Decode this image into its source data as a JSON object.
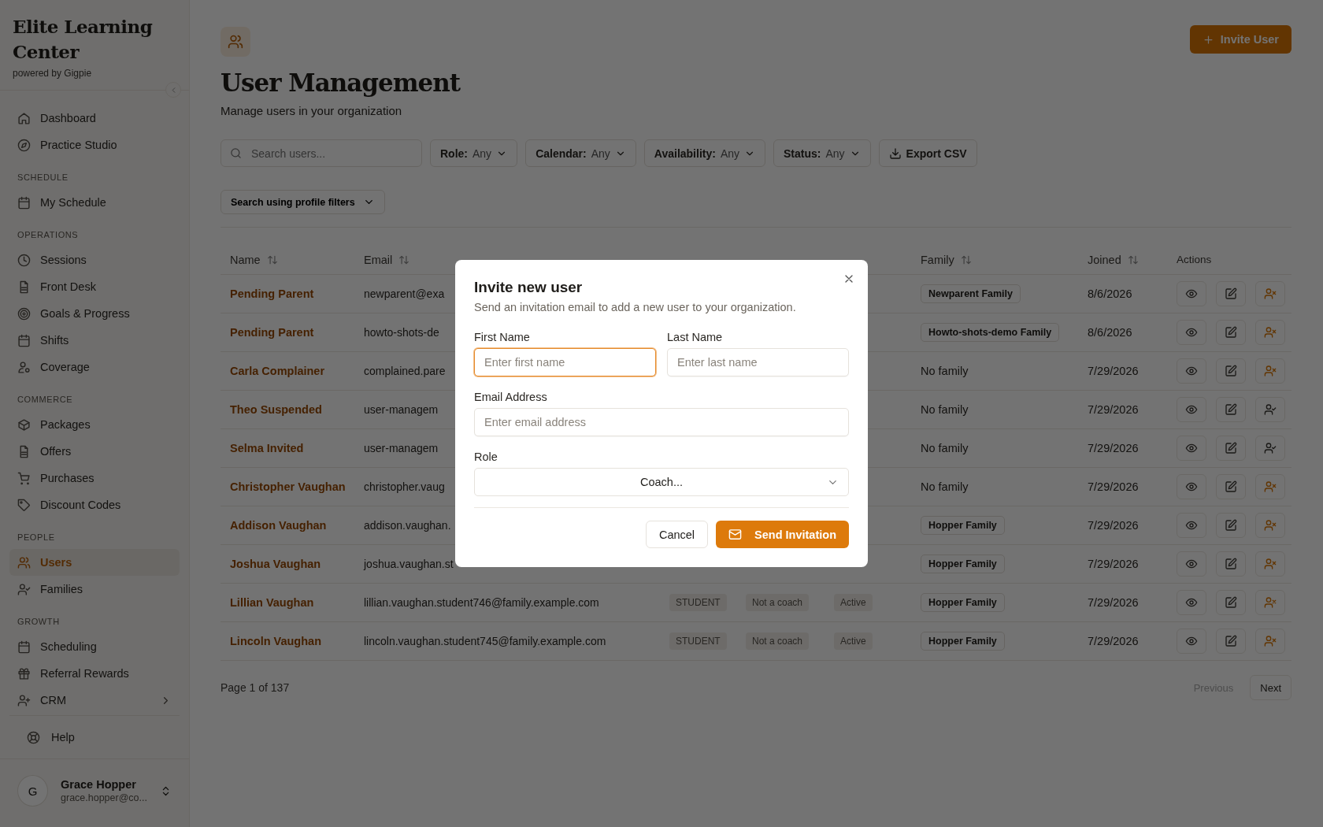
{
  "sidebar": {
    "org_name": "Elite Learning Center",
    "tagline": "powered by Gigpie",
    "sections": [
      {
        "items": [
          {
            "label": "Dashboard",
            "selected": false,
            "has_submenu": false
          },
          {
            "label": "Practice Studio",
            "selected": false,
            "has_submenu": false
          }
        ]
      },
      {
        "label": "SCHEDULE",
        "items": [
          {
            "label": "My Schedule",
            "selected": false,
            "has_submenu": false
          }
        ]
      },
      {
        "label": "OPERATIONS",
        "items": [
          {
            "label": "Sessions",
            "selected": false,
            "has_submenu": false
          },
          {
            "label": "Front Desk",
            "selected": false,
            "has_submenu": false
          },
          {
            "label": "Goals & Progress",
            "selected": false,
            "has_submenu": false
          },
          {
            "label": "Shifts",
            "selected": false,
            "has_submenu": false
          },
          {
            "label": "Coverage",
            "selected": false,
            "has_submenu": false
          }
        ]
      },
      {
        "label": "COMMERCE",
        "items": [
          {
            "label": "Packages",
            "selected": false,
            "has_submenu": false
          },
          {
            "label": "Offers",
            "selected": false,
            "has_submenu": false
          },
          {
            "label": "Purchases",
            "selected": false,
            "has_submenu": false
          },
          {
            "label": "Discount Codes",
            "selected": false,
            "has_submenu": false
          }
        ]
      },
      {
        "label": "PEOPLE",
        "items": [
          {
            "label": "Users",
            "selected": true,
            "has_submenu": false
          },
          {
            "label": "Families",
            "selected": false,
            "has_submenu": false
          }
        ]
      },
      {
        "label": "GROWTH",
        "items": [
          {
            "label": "Scheduling",
            "selected": false,
            "has_submenu": false
          },
          {
            "label": "Referral Rewards",
            "selected": false,
            "has_submenu": false
          },
          {
            "label": "CRM",
            "selected": false,
            "has_submenu": true
          }
        ]
      }
    ],
    "help": "Help",
    "user": {
      "initial": "G",
      "name": "Grace Hopper",
      "email": "grace.hopper@co..."
    }
  },
  "header": {
    "title": "User Management",
    "subtitle": "Manage users in your organization",
    "invite_button": "Invite User"
  },
  "toolbar": {
    "search_placeholder": "Search users...",
    "filters": [
      {
        "label": "Role:",
        "value": "Any"
      },
      {
        "label": "Calendar:",
        "value": "Any"
      },
      {
        "label": "Availability:",
        "value": "Any"
      },
      {
        "label": "Status:",
        "value": "Any"
      }
    ],
    "export_button": "Export CSV",
    "profile_filter": "Search using profile filters"
  },
  "table": {
    "headers": {
      "name": "Name",
      "email": "Email",
      "family": "Family",
      "joined": "Joined",
      "actions": "Actions"
    },
    "rows": [
      {
        "name": "Pending Parent",
        "email": "newparent@exa",
        "family": {
          "kind": "badge",
          "text": "Newparent Family"
        },
        "joined": "8/6/2026",
        "account_active": true
      },
      {
        "name": "Pending Parent",
        "email": "howto-shots-de",
        "family": {
          "kind": "badge",
          "text": "Howto-shots-demo Family"
        },
        "joined": "8/6/2026",
        "account_active": true
      },
      {
        "name": "Carla Complainer",
        "email": "complained.pare",
        "family": {
          "kind": "plain",
          "text": "No family"
        },
        "joined": "7/29/2026",
        "account_active": true
      },
      {
        "name": "Theo Suspended",
        "email": "user-managem",
        "family": {
          "kind": "plain",
          "text": "No family"
        },
        "joined": "7/29/2026",
        "account_active": false
      },
      {
        "name": "Selma Invited",
        "email": "user-managem",
        "family": {
          "kind": "plain",
          "text": "No family"
        },
        "joined": "7/29/2026",
        "account_active": false
      },
      {
        "name": "Christopher Vaughan",
        "email": "christopher.vaug",
        "family": {
          "kind": "plain",
          "text": "No family"
        },
        "joined": "7/29/2026",
        "account_active": true
      },
      {
        "name": "Addison Vaughan",
        "email": "addison.vaughan.",
        "family": {
          "kind": "badge",
          "text": "Hopper Family"
        },
        "joined": "7/29/2026",
        "account_active": true
      },
      {
        "name": "Joshua Vaughan",
        "email": "joshua.vaughan.st",
        "family": {
          "kind": "badge",
          "text": "Hopper Family"
        },
        "joined": "7/29/2026",
        "account_active": true
      },
      {
        "name": "Lillian Vaughan",
        "email": "lillian.vaughan.student746@family.example.com",
        "role": "STUDENT",
        "availability": "Not a coach",
        "status": "Active",
        "family": {
          "kind": "badge",
          "text": "Hopper Family"
        },
        "joined": "7/29/2026",
        "account_active": true
      },
      {
        "name": "Lincoln Vaughan",
        "email": "lincoln.vaughan.student745@family.example.com",
        "role": "STUDENT",
        "availability": "Not a coach",
        "status": "Active",
        "family": {
          "kind": "badge",
          "text": "Hopper Family"
        },
        "joined": "7/29/2026",
        "account_active": true
      }
    ]
  },
  "pagination": {
    "summary": "Page 1 of 137",
    "previous": {
      "label": "Previous",
      "disabled": true
    },
    "next": {
      "label": "Next",
      "disabled": false
    }
  },
  "modal": {
    "title": "Invite new user",
    "description": "Send an invitation email to add a new user to your organization.",
    "field_rows": [
      [
        {
          "kind": "text",
          "label": "First Name",
          "placeholder": "Enter first name",
          "focused": true
        },
        {
          "kind": "text",
          "label": "Last Name",
          "placeholder": "Enter last name",
          "focused": false
        }
      ],
      [
        {
          "kind": "text",
          "label": "Email Address",
          "placeholder": "Enter email address",
          "focused": false
        }
      ],
      [
        {
          "kind": "select",
          "label": "Role",
          "value": "Coach...",
          "focused": false
        }
      ]
    ],
    "cancel_button": "Cancel",
    "submit_button": "Send Invitation"
  }
}
